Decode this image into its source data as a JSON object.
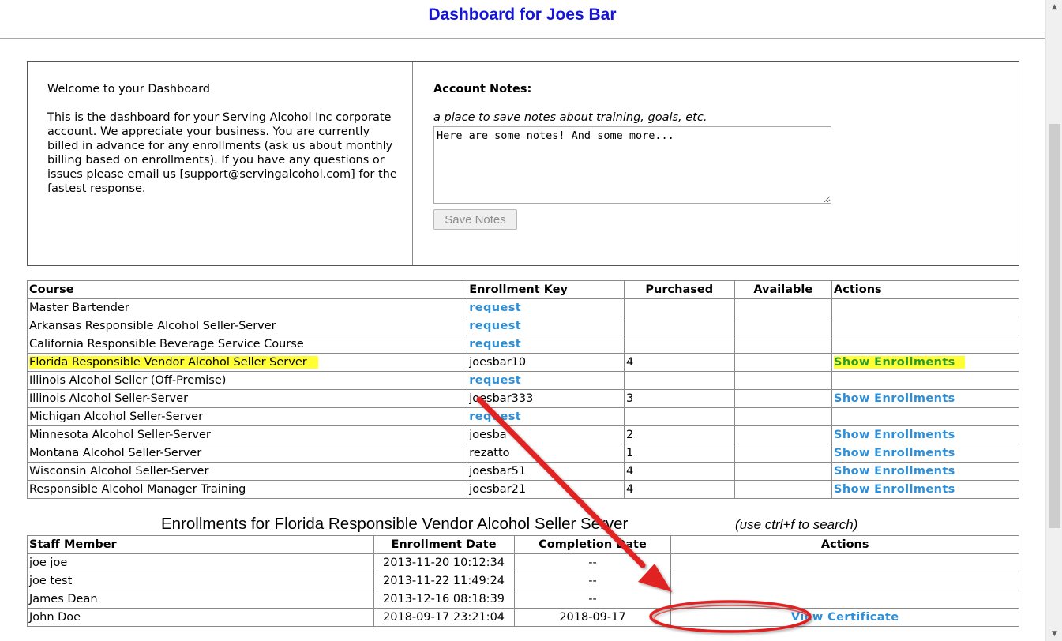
{
  "header": {
    "title": "Dashboard for Joes Bar"
  },
  "welcome": {
    "title": "Welcome to your Dashboard",
    "body": "This is the dashboard for your Serving Alcohol Inc corporate account. We appreciate your business. You are currently billed in advance for any enrollments (ask us about monthly billing based on enrollments). If you have any questions or issues please email us [support@servingalcohol.com] for the fastest response."
  },
  "notes": {
    "title": "Account Notes:",
    "subtitle": "a place to save notes about training, goals, etc.",
    "value": "Here are some notes! And some more...",
    "save_label": "Save Notes"
  },
  "courses": {
    "headers": {
      "course": "Course",
      "key": "Enrollment Key",
      "purchased": "Purchased",
      "available": "Available",
      "actions": "Actions"
    },
    "rows": [
      {
        "course": "Master Bartender",
        "key": "request",
        "key_is_link": true,
        "purchased": "",
        "available": "",
        "action": ""
      },
      {
        "course": "Arkansas Responsible Alcohol Seller-Server",
        "key": "request",
        "key_is_link": true,
        "purchased": "",
        "available": "",
        "action": ""
      },
      {
        "course": "California Responsible Beverage Service Course",
        "key": "request",
        "key_is_link": true,
        "purchased": "",
        "available": "",
        "action": ""
      },
      {
        "course": "Florida Responsible Vendor Alcohol Seller Server",
        "key": "joesbar10",
        "key_is_link": false,
        "purchased": "4",
        "available": "",
        "action": "Show Enrollments",
        "highlighted": true
      },
      {
        "course": "Illinois Alcohol Seller (Off-Premise)",
        "key": "request",
        "key_is_link": true,
        "purchased": "",
        "available": "",
        "action": ""
      },
      {
        "course": "Illinois Alcohol Seller-Server",
        "key": "joesbar333",
        "key_is_link": false,
        "purchased": "3",
        "available": "",
        "action": "Show Enrollments"
      },
      {
        "course": "Michigan Alcohol Seller-Server",
        "key": "request",
        "key_is_link": true,
        "purchased": "",
        "available": "",
        "action": ""
      },
      {
        "course": "Minnesota Alcohol Seller-Server",
        "key": "joesba",
        "key_is_link": false,
        "purchased": "2",
        "available": "",
        "action": "Show Enrollments"
      },
      {
        "course": "Montana Alcohol Seller-Server",
        "key": "rezatto",
        "key_is_link": false,
        "purchased": "1",
        "available": "",
        "action": "Show Enrollments"
      },
      {
        "course": "Wisconsin Alcohol Seller-Server",
        "key": "joesbar51",
        "key_is_link": false,
        "purchased": "4",
        "available": "",
        "action": "Show Enrollments"
      },
      {
        "course": "Responsible Alcohol Manager Training",
        "key": "joesbar21",
        "key_is_link": false,
        "purchased": "4",
        "available": "",
        "action": "Show Enrollments"
      }
    ]
  },
  "enrollments": {
    "title": "Enrollments for Florida Responsible Vendor Alcohol Seller Server",
    "hint": "(use ctrl+f to search)",
    "headers": {
      "staff": "Staff Member",
      "date": "Enrollment Date",
      "completion": "Completion Date",
      "actions": "Actions"
    },
    "rows": [
      {
        "staff": "joe joe",
        "date": "2013-11-20 10:12:34",
        "completion": "--",
        "action": ""
      },
      {
        "staff": "joe test",
        "date": "2013-11-22 11:49:24",
        "completion": "--",
        "action": ""
      },
      {
        "staff": "James Dean",
        "date": "2013-12-16 08:18:39",
        "completion": "--",
        "action": ""
      },
      {
        "staff": "John Doe",
        "date": "2018-09-17 23:21:04",
        "completion": "2018-09-17",
        "action": "View Certificate"
      }
    ]
  },
  "colors": {
    "title_blue": "#1515d6",
    "link_blue": "#2f8fd6",
    "highlight_yellow": "#ffff33",
    "highlight_action_green": "#2e9a2e",
    "annotation_red": "#e02020"
  },
  "icons": {
    "scroll_up": "scroll-up-arrow-icon",
    "scroll_down": "scroll-down-arrow-icon",
    "arrow": "red-annotation-arrow-icon",
    "circle": "red-annotation-circle-icon"
  }
}
